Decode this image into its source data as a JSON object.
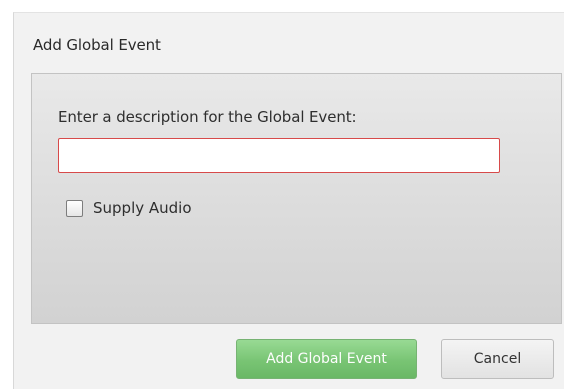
{
  "dialog": {
    "title": "Add Global Event",
    "prompt": "Enter a description for the Global Event:",
    "description_value": "",
    "supply_audio_label": "Supply Audio",
    "supply_audio_checked": false,
    "add_button_label": "Add Global Event",
    "cancel_button_label": "Cancel"
  },
  "colors": {
    "input_border_error": "#d74a4a",
    "primary_button": "#6cc067",
    "dialog_background": "#f2f2f2"
  }
}
